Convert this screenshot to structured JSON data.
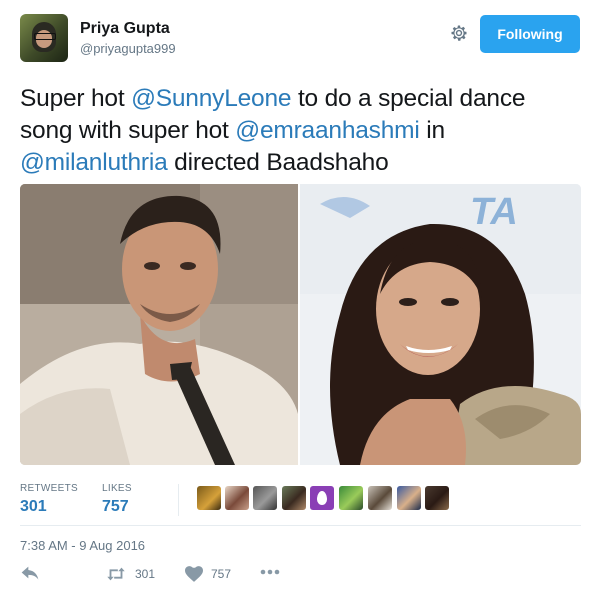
{
  "author": {
    "name": "Priya Gupta",
    "handle": "@priyagupta999"
  },
  "header": {
    "follow_label": "Following",
    "settings_icon": "gear-icon"
  },
  "tweet": {
    "segments": [
      {
        "text": "Super hot ",
        "type": "text"
      },
      {
        "text": "@SunnyLeone",
        "type": "mention"
      },
      {
        "text": " to do a special dance song with super hot ",
        "type": "text"
      },
      {
        "text": "@emraanhashmi",
        "type": "mention"
      },
      {
        "text": " in ",
        "type": "text"
      },
      {
        "text": "@milanluthria",
        "type": "mention"
      },
      {
        "text": " directed Baadshaho",
        "type": "text"
      }
    ]
  },
  "stats": {
    "retweets_label": "RETWEETS",
    "retweets_count": "301",
    "likes_label": "LIKES",
    "likes_count": "757"
  },
  "timestamp": "7:38 AM - 9 Aug 2016",
  "actions": {
    "reply_icon": "reply-icon",
    "retweet_icon": "retweet-icon",
    "retweet_count": "301",
    "like_icon": "heart-icon",
    "like_count": "757",
    "more_icon": "more-icon"
  },
  "colors": {
    "accent": "#2aa3ef",
    "mention": "#2b7bb9",
    "muted": "#657786",
    "text": "#14171a"
  }
}
